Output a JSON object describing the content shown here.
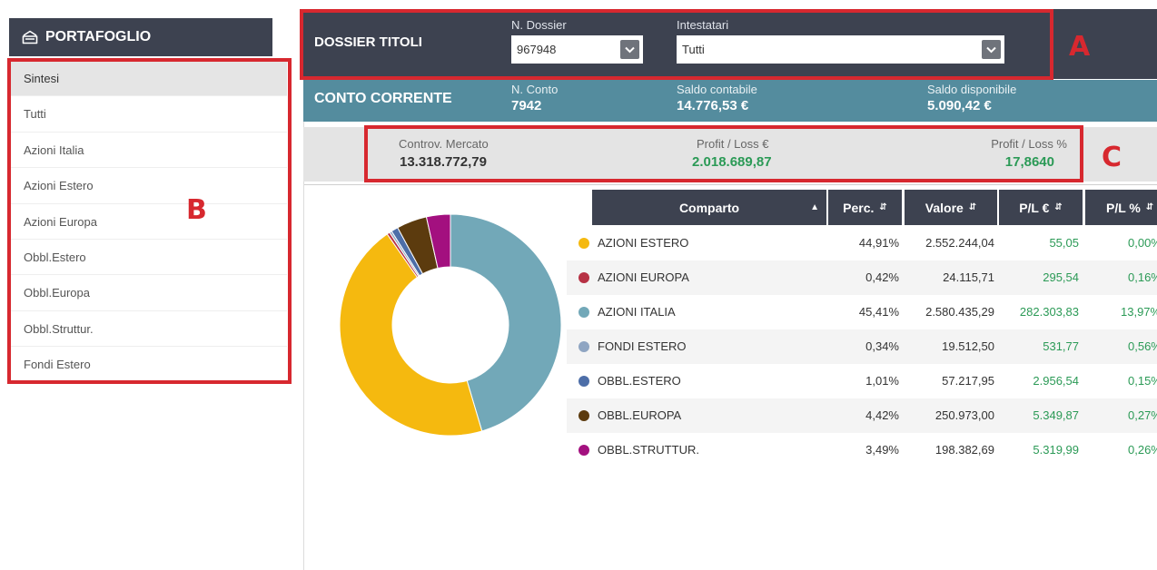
{
  "sidebar": {
    "title": "PORTAFOGLIO",
    "items": [
      {
        "label": "Sintesi"
      },
      {
        "label": "Tutti"
      },
      {
        "label": "Azioni Italia"
      },
      {
        "label": "Azioni Estero"
      },
      {
        "label": "Azioni Europa"
      },
      {
        "label": "Obbl.Estero"
      },
      {
        "label": "Obbl.Europa"
      },
      {
        "label": "Obbl.Struttur."
      },
      {
        "label": "Fondi Estero"
      }
    ]
  },
  "annotations": {
    "a": "A",
    "b": "B",
    "c": "C"
  },
  "dossier": {
    "title": "DOSSIER TITOLI",
    "n_dossier_label": "N. Dossier",
    "n_dossier_value": "967948",
    "intestatari_label": "Intestatari",
    "intestatari_value": "Tutti"
  },
  "conto": {
    "title": "CONTO CORRENTE",
    "n_conto_label": "N. Conto",
    "n_conto_value": "7942",
    "saldo_contabile_label": "Saldo contabile",
    "saldo_contabile_value": "14.776,53 €",
    "saldo_disponibile_label": "Saldo disponibile",
    "saldo_disponibile_value": "5.090,42 €"
  },
  "metrics": {
    "controv_label": "Controv. Mercato",
    "controv_value": "13.318.772,79",
    "pl_eur_label": "Profit / Loss €",
    "pl_eur_value": "2.018.689,87",
    "pl_pct_label": "Profit / Loss %",
    "pl_pct_value": "17,8640"
  },
  "table": {
    "headers": {
      "comparto": "Comparto",
      "perc": "Perc.",
      "valore": "Valore",
      "pl_eur": "P/L €",
      "pl_pct": "P/L %"
    },
    "rows": [
      {
        "comparto": "AZIONI ESTERO",
        "perc": "44,91%",
        "valore": "2.552.244,04",
        "pl_eur": "55,05",
        "pl_pct": "0,00%",
        "color": "#f5b90f"
      },
      {
        "comparto": "AZIONI EUROPA",
        "perc": "0,42%",
        "valore": "24.115,71",
        "pl_eur": "295,54",
        "pl_pct": "0,16%",
        "color": "#b73245"
      },
      {
        "comparto": "AZIONI ITALIA",
        "perc": "45,41%",
        "valore": "2.580.435,29",
        "pl_eur": "282.303,83",
        "pl_pct": "13,97%",
        "color": "#72a8b8"
      },
      {
        "comparto": "FONDI ESTERO",
        "perc": "0,34%",
        "valore": "19.512,50",
        "pl_eur": "531,77",
        "pl_pct": "0,56%",
        "color": "#8fa5c2"
      },
      {
        "comparto": "OBBL.ESTERO",
        "perc": "1,01%",
        "valore": "57.217,95",
        "pl_eur": "2.956,54",
        "pl_pct": "0,15%",
        "color": "#4d6ea8"
      },
      {
        "comparto": "OBBL.EUROPA",
        "perc": "4,42%",
        "valore": "250.973,00",
        "pl_eur": "5.349,87",
        "pl_pct": "0,27%",
        "color": "#5c3b0e"
      },
      {
        "comparto": "OBBL.STRUTTUR.",
        "perc": "3,49%",
        "valore": "198.382,69",
        "pl_eur": "5.319,99",
        "pl_pct": "0,26%",
        "color": "#a3107f"
      }
    ]
  },
  "chart_data": {
    "type": "pie",
    "categories": [
      "AZIONI ITALIA",
      "AZIONI ESTERO",
      "AZIONI EUROPA",
      "FONDI ESTERO",
      "OBBL.ESTERO",
      "OBBL.EUROPA",
      "OBBL.STRUTTUR."
    ],
    "values": [
      45.41,
      44.91,
      0.42,
      0.34,
      1.01,
      4.42,
      3.49
    ],
    "colors": [
      "#72a8b8",
      "#f5b90f",
      "#b73245",
      "#8fa5c2",
      "#4d6ea8",
      "#5c3b0e",
      "#a3107f"
    ],
    "donut": true
  }
}
